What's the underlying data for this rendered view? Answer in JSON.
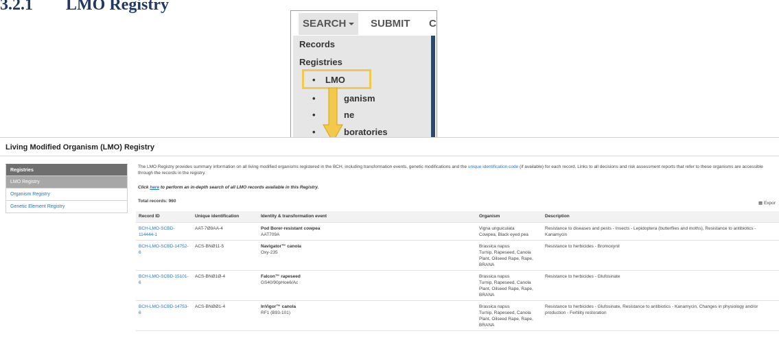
{
  "heading": {
    "number": "3.2.1",
    "title": "LMO Registry"
  },
  "menu": {
    "top": {
      "search": "SEARCH",
      "submit": "SUBMIT",
      "next": "C"
    },
    "dropdown": {
      "records": "Records",
      "registries": "Registries",
      "items": [
        {
          "bullet": "•",
          "label": "LMO"
        },
        {
          "bullet": "•",
          "label": "ganism"
        },
        {
          "bullet": "•",
          "label": "ne"
        },
        {
          "bullet": "•",
          "label": "boratories"
        }
      ]
    },
    "highlight_color": "#f2c94c",
    "arrow_color": "#f2c94c"
  },
  "registry": {
    "title": "Living Modified Organism (LMO) Registry",
    "sidebar": [
      {
        "label": "Registries",
        "state": "header"
      },
      {
        "label": "LMO Registry",
        "state": "active"
      },
      {
        "label": "Organism Registry",
        "state": "link"
      },
      {
        "label": "Genetic Element Registry",
        "state": "link"
      }
    ],
    "intro_before_link": "The LMO Registry provides summary information on all living modified organisms registered in the BCH, including transformation events, genetic modifications and the ",
    "intro_link": "unique identification code",
    "intro_after_link": " (if available) for each record. Links to all decisions and risk assessment reports that refer to these organisms are accessible through the records in the registry.",
    "click_prefix": "Click ",
    "click_link": "here",
    "click_suffix": " to perform an in-depth search of all LMO records available in this Registry.",
    "total_records": "Total records: 960",
    "export_label": "Expor",
    "columns": [
      "Record ID",
      "Unique identification",
      "Identity & transformation event",
      "Organism",
      "Description"
    ],
    "rows": [
      {
        "record_id": "BCH-LMO-SCBD-114444-1",
        "unique_id": "AAT-7Ø9AA-4",
        "identity": "Pod Borer-resistant cowpea",
        "event": "AAT709A",
        "organism": "Vigna unguiculata",
        "organism_common": "Cowpea, Black eyed pea",
        "description": "Resistance to diseases and pests - Insects - Lepidoptera (butterflies and moths), Resistance to antibiotics - Kanamycin"
      },
      {
        "record_id": "BCH-LMO-SCBD-14752-6",
        "unique_id": "ACS-BNØ11-5",
        "identity": "Navigator™ canola",
        "event": "Oxy-235",
        "organism": "Brassica napus",
        "organism_common": "Turnip, Rapeseed, Canola Plant, Oilseed Rape, Rape, BRANA",
        "description": "Resistance to herbicides - Bromoxynil"
      },
      {
        "record_id": "BCH-LMO-SCBD-15101-6",
        "unique_id": "ACS-BNØ1Ø-4",
        "identity": "Falcon™ rapeseed",
        "event": "GS40/90pHoe6/Ac",
        "organism": "Brassica napus",
        "organism_common": "Turnip, Rapeseed, Canola Plant, Oilseed Rape, Rape, BRANA",
        "description": "Resistance to herbicides - Glufosinate"
      },
      {
        "record_id": "BCH-LMO-SCBD-14753-6",
        "unique_id": "ACS-BNØØ1-4",
        "identity": "InVigor™ canola",
        "event": "RF1 (B93-101)",
        "organism": "Brassica napus",
        "organism_common": "Turnip, Rapeseed, Canola Plant, Oilseed Rape, Rape, BRANA",
        "description": "Resistance to herbicides - Glufosinate, Resistance to antibiotics - Kanamycin, Changes in physiology and/or production - Fertility restoration"
      }
    ]
  }
}
